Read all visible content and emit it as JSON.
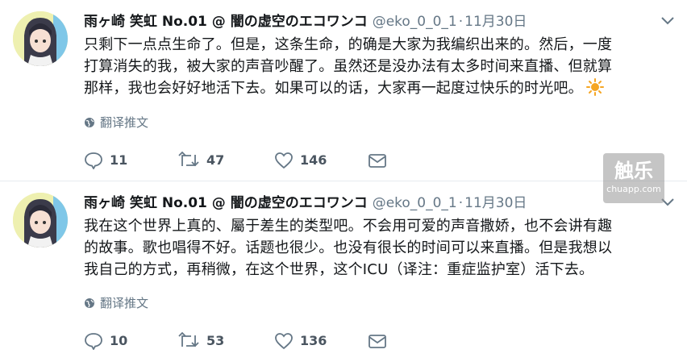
{
  "tweets": [
    {
      "display_name": "雨ヶ崎 笑虹 No.01 @ 闇の虚空のエコワンコ",
      "handle": "@eko_0_0_1",
      "separator": "·",
      "time": "11月30日",
      "text_lines": [
        "只剩下一点点生命了。但是，这条生命，的确是大家为我编织出来的。然后，一度",
        "打算消失的我，被大家的声音吵醒了。虽然还是没办法有太多时间来直播、但就算",
        "那样，我也会好好地活下去。如果可以的话，大家再一起度过快乐的时光吧。"
      ],
      "emoji": "sun-icon",
      "translate_label": "翻译推文",
      "replies": "11",
      "retweets": "47",
      "likes": "146"
    },
    {
      "display_name": "雨ヶ崎 笑虹 No.01 @ 闇の虚空のエコワンコ",
      "handle": "@eko_0_0_1",
      "separator": "·",
      "time": "11月30日",
      "text_lines": [
        "我在这个世界上真的、屬于差生的类型吧。不会用可爱的声音撒娇，也不会讲有趣",
        "的故事。歌也唱得不好。话题也很少。也没有很长的时间可以来直播。但是我想以",
        "我自己的方式，再稍微，在这个世界，这个ICU（译注：重症监护室）活下去。"
      ],
      "translate_label": "翻译推文",
      "replies": "10",
      "retweets": "53",
      "likes": "136"
    }
  ],
  "watermark": {
    "main": "触乐",
    "sub": "chuapp.com"
  },
  "colors": {
    "text": "#14171a",
    "muted": "#657786",
    "divider": "#e6ecf0",
    "sun": "#f5a623"
  }
}
